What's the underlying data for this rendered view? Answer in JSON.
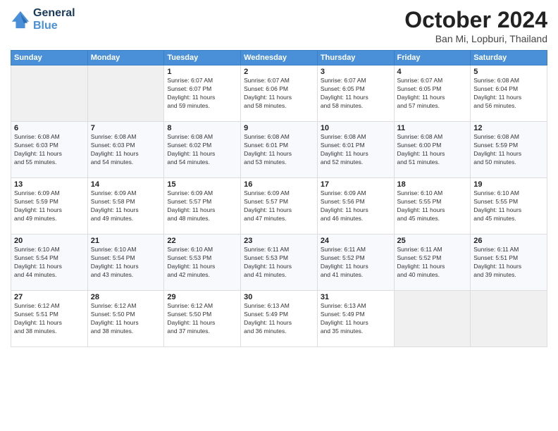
{
  "header": {
    "logo_line1": "General",
    "logo_line2": "Blue",
    "month_title": "October 2024",
    "location": "Ban Mi, Lopburi, Thailand"
  },
  "weekdays": [
    "Sunday",
    "Monday",
    "Tuesday",
    "Wednesday",
    "Thursday",
    "Friday",
    "Saturday"
  ],
  "weeks": [
    [
      {
        "day": "",
        "info": ""
      },
      {
        "day": "",
        "info": ""
      },
      {
        "day": "1",
        "info": "Sunrise: 6:07 AM\nSunset: 6:07 PM\nDaylight: 11 hours\nand 59 minutes."
      },
      {
        "day": "2",
        "info": "Sunrise: 6:07 AM\nSunset: 6:06 PM\nDaylight: 11 hours\nand 58 minutes."
      },
      {
        "day": "3",
        "info": "Sunrise: 6:07 AM\nSunset: 6:05 PM\nDaylight: 11 hours\nand 58 minutes."
      },
      {
        "day": "4",
        "info": "Sunrise: 6:07 AM\nSunset: 6:05 PM\nDaylight: 11 hours\nand 57 minutes."
      },
      {
        "day": "5",
        "info": "Sunrise: 6:08 AM\nSunset: 6:04 PM\nDaylight: 11 hours\nand 56 minutes."
      }
    ],
    [
      {
        "day": "6",
        "info": "Sunrise: 6:08 AM\nSunset: 6:03 PM\nDaylight: 11 hours\nand 55 minutes."
      },
      {
        "day": "7",
        "info": "Sunrise: 6:08 AM\nSunset: 6:03 PM\nDaylight: 11 hours\nand 54 minutes."
      },
      {
        "day": "8",
        "info": "Sunrise: 6:08 AM\nSunset: 6:02 PM\nDaylight: 11 hours\nand 54 minutes."
      },
      {
        "day": "9",
        "info": "Sunrise: 6:08 AM\nSunset: 6:01 PM\nDaylight: 11 hours\nand 53 minutes."
      },
      {
        "day": "10",
        "info": "Sunrise: 6:08 AM\nSunset: 6:01 PM\nDaylight: 11 hours\nand 52 minutes."
      },
      {
        "day": "11",
        "info": "Sunrise: 6:08 AM\nSunset: 6:00 PM\nDaylight: 11 hours\nand 51 minutes."
      },
      {
        "day": "12",
        "info": "Sunrise: 6:08 AM\nSunset: 5:59 PM\nDaylight: 11 hours\nand 50 minutes."
      }
    ],
    [
      {
        "day": "13",
        "info": "Sunrise: 6:09 AM\nSunset: 5:59 PM\nDaylight: 11 hours\nand 49 minutes."
      },
      {
        "day": "14",
        "info": "Sunrise: 6:09 AM\nSunset: 5:58 PM\nDaylight: 11 hours\nand 49 minutes."
      },
      {
        "day": "15",
        "info": "Sunrise: 6:09 AM\nSunset: 5:57 PM\nDaylight: 11 hours\nand 48 minutes."
      },
      {
        "day": "16",
        "info": "Sunrise: 6:09 AM\nSunset: 5:57 PM\nDaylight: 11 hours\nand 47 minutes."
      },
      {
        "day": "17",
        "info": "Sunrise: 6:09 AM\nSunset: 5:56 PM\nDaylight: 11 hours\nand 46 minutes."
      },
      {
        "day": "18",
        "info": "Sunrise: 6:10 AM\nSunset: 5:55 PM\nDaylight: 11 hours\nand 45 minutes."
      },
      {
        "day": "19",
        "info": "Sunrise: 6:10 AM\nSunset: 5:55 PM\nDaylight: 11 hours\nand 45 minutes."
      }
    ],
    [
      {
        "day": "20",
        "info": "Sunrise: 6:10 AM\nSunset: 5:54 PM\nDaylight: 11 hours\nand 44 minutes."
      },
      {
        "day": "21",
        "info": "Sunrise: 6:10 AM\nSunset: 5:54 PM\nDaylight: 11 hours\nand 43 minutes."
      },
      {
        "day": "22",
        "info": "Sunrise: 6:10 AM\nSunset: 5:53 PM\nDaylight: 11 hours\nand 42 minutes."
      },
      {
        "day": "23",
        "info": "Sunrise: 6:11 AM\nSunset: 5:53 PM\nDaylight: 11 hours\nand 41 minutes."
      },
      {
        "day": "24",
        "info": "Sunrise: 6:11 AM\nSunset: 5:52 PM\nDaylight: 11 hours\nand 41 minutes."
      },
      {
        "day": "25",
        "info": "Sunrise: 6:11 AM\nSunset: 5:52 PM\nDaylight: 11 hours\nand 40 minutes."
      },
      {
        "day": "26",
        "info": "Sunrise: 6:11 AM\nSunset: 5:51 PM\nDaylight: 11 hours\nand 39 minutes."
      }
    ],
    [
      {
        "day": "27",
        "info": "Sunrise: 6:12 AM\nSunset: 5:51 PM\nDaylight: 11 hours\nand 38 minutes."
      },
      {
        "day": "28",
        "info": "Sunrise: 6:12 AM\nSunset: 5:50 PM\nDaylight: 11 hours\nand 38 minutes."
      },
      {
        "day": "29",
        "info": "Sunrise: 6:12 AM\nSunset: 5:50 PM\nDaylight: 11 hours\nand 37 minutes."
      },
      {
        "day": "30",
        "info": "Sunrise: 6:13 AM\nSunset: 5:49 PM\nDaylight: 11 hours\nand 36 minutes."
      },
      {
        "day": "31",
        "info": "Sunrise: 6:13 AM\nSunset: 5:49 PM\nDaylight: 11 hours\nand 35 minutes."
      },
      {
        "day": "",
        "info": ""
      },
      {
        "day": "",
        "info": ""
      }
    ]
  ]
}
